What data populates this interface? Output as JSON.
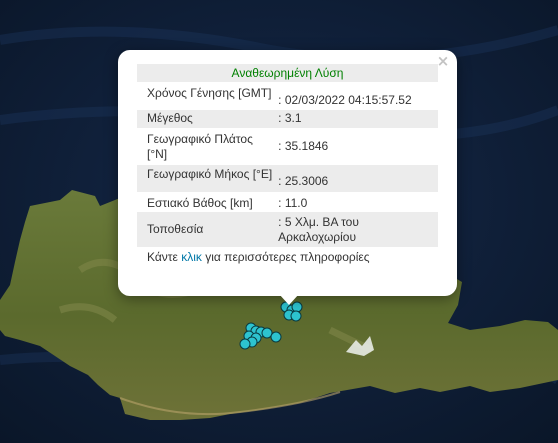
{
  "popup": {
    "title": "Αναθεωρημένη Λύση",
    "close_symbol": "×",
    "rows": [
      {
        "label": "Χρόνος Γένησης [GMT]",
        "value": ": 02/03/2022 04:15:57.52"
      },
      {
        "label": "Μέγεθος",
        "value": ": 3.1"
      },
      {
        "label": "Γεωγραφικό Πλάτος [°N]",
        "value": ": 35.1846"
      },
      {
        "label": "Γεωγραφικό Μήκος [°E]",
        "value": ": 25.3006"
      },
      {
        "label": "Εστιακό Βάθος [km]",
        "value": ": 11.0"
      },
      {
        "label": "Τοποθεσία",
        "value": ": 5 Χλμ. ΒΑ του Αρκαλοχωρίου"
      }
    ],
    "more_prefix": "Κάντε ",
    "more_link": "κλικ",
    "more_suffix": " για περισσότερες πληροφορίες"
  },
  "map": {
    "background": "satellite",
    "marker_color": "#2dc3cf",
    "marker_outline": "#0a3a40",
    "sea_color": "#0e1e36",
    "land_color": "#5a6d2e"
  }
}
